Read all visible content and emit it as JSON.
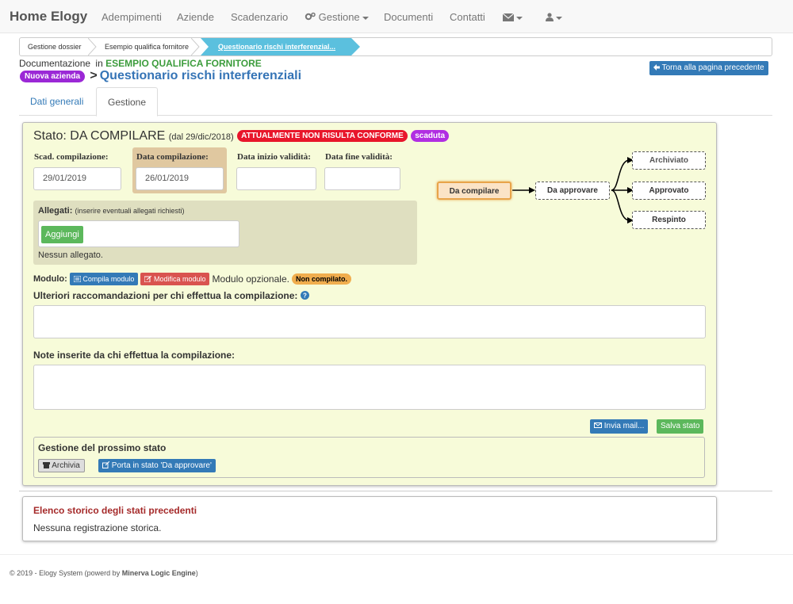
{
  "navbar": {
    "brand": "Home Elogy",
    "items": [
      "Adempimenti",
      "Aziende",
      "Scadenzario",
      "Gestione",
      "Documenti",
      "Contatti"
    ]
  },
  "breadcrumb": [
    "Gestione dossier",
    "Esempio qualifica fornitore",
    "Questionario rischi interferenzial..."
  ],
  "header": {
    "doc_prefix": "Documentazione",
    "doc_in": "in",
    "company": "ESEMPIO QUALIFICA FORNITORE",
    "new_company_badge": "Nuova azienda",
    "chevron": ">",
    "title": "Questionario rischi interferenziali",
    "back_button": "Torna alla pagina precedente"
  },
  "tabs": [
    "Dati generali",
    "Gestione"
  ],
  "status": {
    "label": "Stato:",
    "value": "DA COMPILARE",
    "since": "(dal 29/dic/2018)",
    "conformity_badge": "ATTUALMENTE NON RISULTA CONFORME",
    "expired_badge": "scaduta"
  },
  "fields": {
    "scad_label": "Scad. compilazione:",
    "scad_value": "29/01/2019",
    "data_comp_label": "Data compilazione:",
    "data_comp_value": "26/01/2019",
    "inizio_label": "Data inizio validità:",
    "inizio_value": "",
    "fine_label": "Data fine validità:",
    "fine_value": ""
  },
  "attachments": {
    "label": "Allegati:",
    "hint": "(inserire eventuali allegati richiesti)",
    "add_button": "Aggiungi",
    "empty": "Nessun allegato."
  },
  "module": {
    "label": "Modulo:",
    "compile_button": "Compila modulo",
    "edit_button": "Modifica modulo",
    "optional_text": "Modulo opzionale.",
    "status_badge": "Non compilato."
  },
  "recommendations": {
    "label": "Ulteriori raccomandazioni per chi effettua la compilazione:",
    "value": ""
  },
  "notes": {
    "label": "Note inserite da chi effettua la compilazione:",
    "value": ""
  },
  "actions": {
    "send_mail": "Invia mail...",
    "save_state": "Salva stato"
  },
  "next_state": {
    "title": "Gestione del prossimo stato",
    "archive_button": "Archivia",
    "to_approve_button": "Porta in stato 'Da approvare'"
  },
  "workflow": {
    "current": "Da compilare",
    "next": "Da approvare",
    "outcomes": [
      "Archiviato",
      "Approvato",
      "Respinto"
    ]
  },
  "history": {
    "title": "Elenco storico degli stati precedenti",
    "empty": "Nessuna registrazione storica."
  },
  "footer": {
    "prefix": "© 2019 - Elogy System (powerd by",
    "engine": "Minerva Logic Engine",
    "suffix": ")"
  },
  "colors": {
    "primary": "#337ab7",
    "success": "#5cb85c",
    "danger": "#d9534f",
    "panel_bg": "#f7fbd9",
    "badge_red": "#e8162b",
    "badge_purple": "#9b28d6"
  }
}
